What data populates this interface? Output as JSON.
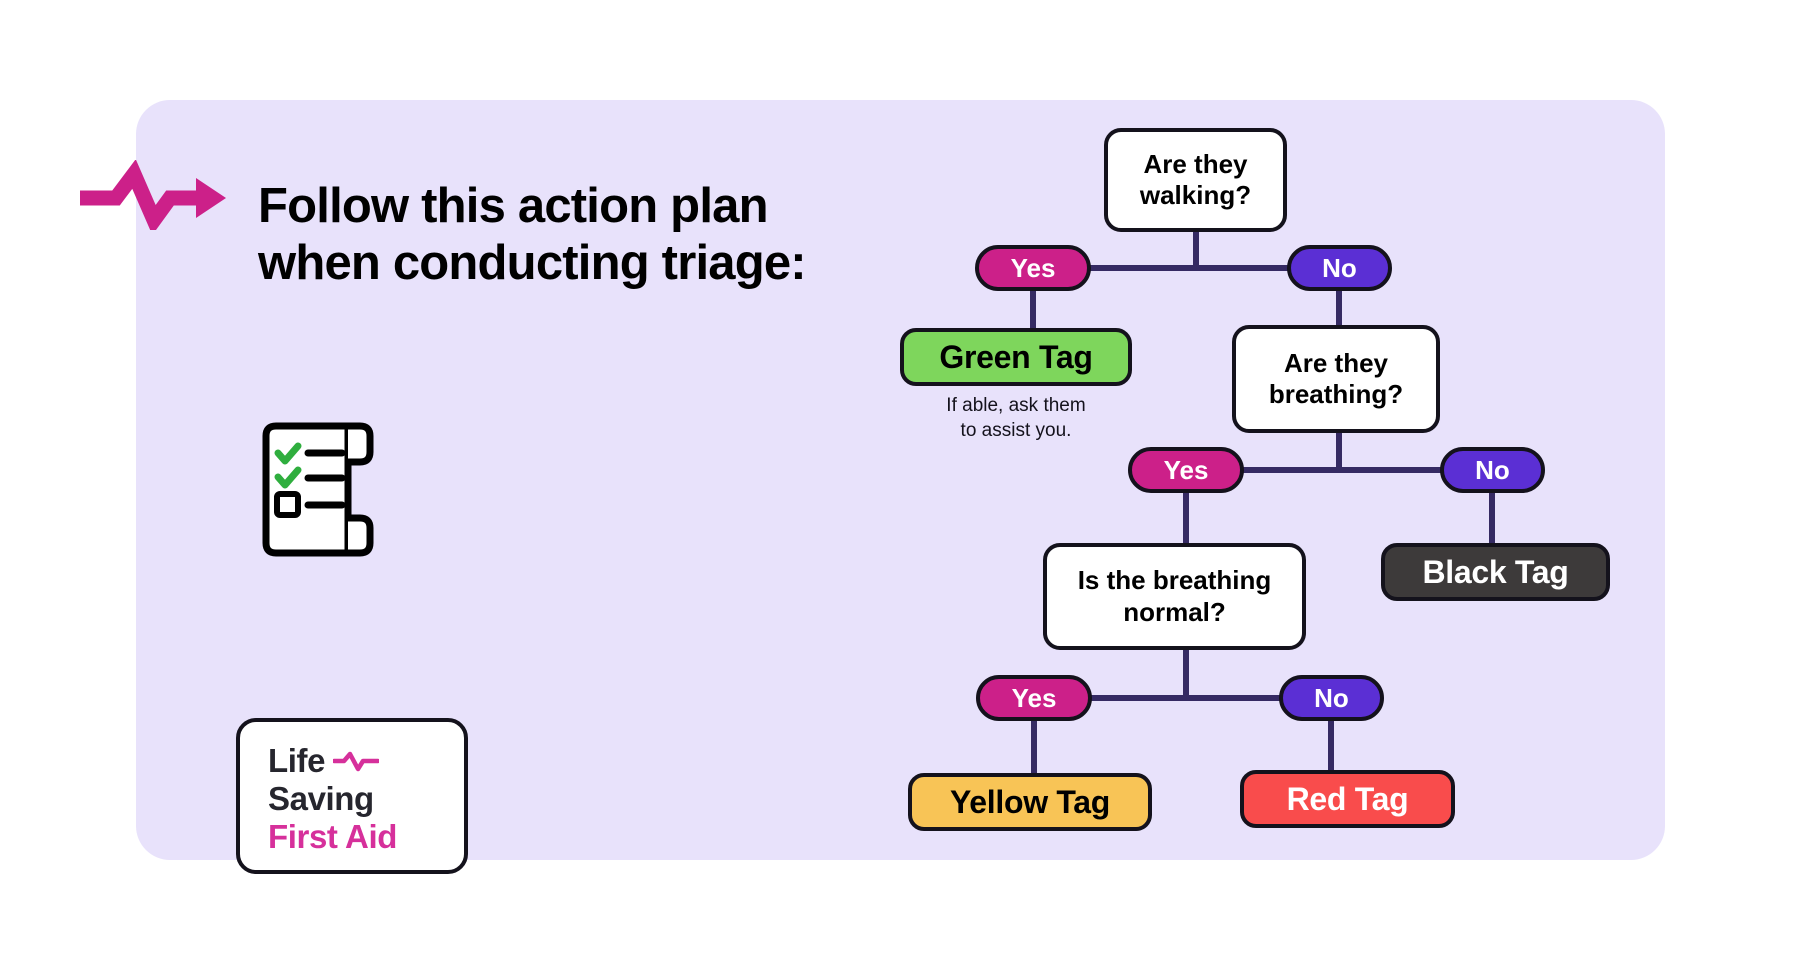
{
  "panel": {
    "background_color": "#e8e2fb"
  },
  "header": {
    "pulse_icon": "heartbeat-arrow-icon",
    "pulse_color": "#cc2089",
    "title": "Follow this action plan when conducting triage:"
  },
  "checklist": {
    "icon": "checklist-scroll-icon",
    "check_color": "#2fae3e",
    "checked_items": 2,
    "unchecked_items": 1
  },
  "logo": {
    "line1": "Life",
    "line2": "Saving",
    "line3": "First Aid",
    "beat_icon": "heartbeat-icon",
    "dark_color": "#26262e",
    "pink_color": "#d6309b"
  },
  "flow": {
    "nodes": [
      {
        "id": "q1",
        "kind": "question",
        "label": "Are they\nwalking?"
      },
      {
        "id": "q1_yes",
        "kind": "pill-yes",
        "label": "Yes"
      },
      {
        "id": "q1_no",
        "kind": "pill-no",
        "label": "No"
      },
      {
        "id": "green",
        "kind": "tag-green",
        "label": "Green Tag"
      },
      {
        "id": "green_note",
        "kind": "note",
        "label": "If able, ask them\nto assist you."
      },
      {
        "id": "q2",
        "kind": "question",
        "label": "Are they\nbreathing?"
      },
      {
        "id": "q2_yes",
        "kind": "pill-yes",
        "label": "Yes"
      },
      {
        "id": "q2_no",
        "kind": "pill-no",
        "label": "No"
      },
      {
        "id": "black",
        "kind": "tag-black",
        "label": "Black Tag"
      },
      {
        "id": "q3",
        "kind": "question",
        "label": "Is the breathing\nnormal?"
      },
      {
        "id": "q3_yes",
        "kind": "pill-yes",
        "label": "Yes"
      },
      {
        "id": "q3_no",
        "kind": "pill-no",
        "label": "No"
      },
      {
        "id": "yellow",
        "kind": "tag-yellow",
        "label": "Yellow Tag"
      },
      {
        "id": "red",
        "kind": "tag-red",
        "label": "Red Tag"
      }
    ],
    "colors": {
      "yes": "#cc2089",
      "no": "#5b2fd4",
      "green_tag": "#7ed65c",
      "black_tag": "#3d3a3a",
      "yellow_tag": "#f8c456",
      "red_tag": "#f94c4c",
      "connector": "#352a63",
      "outline": "#14121c",
      "question_fill": "#ffffff"
    }
  }
}
